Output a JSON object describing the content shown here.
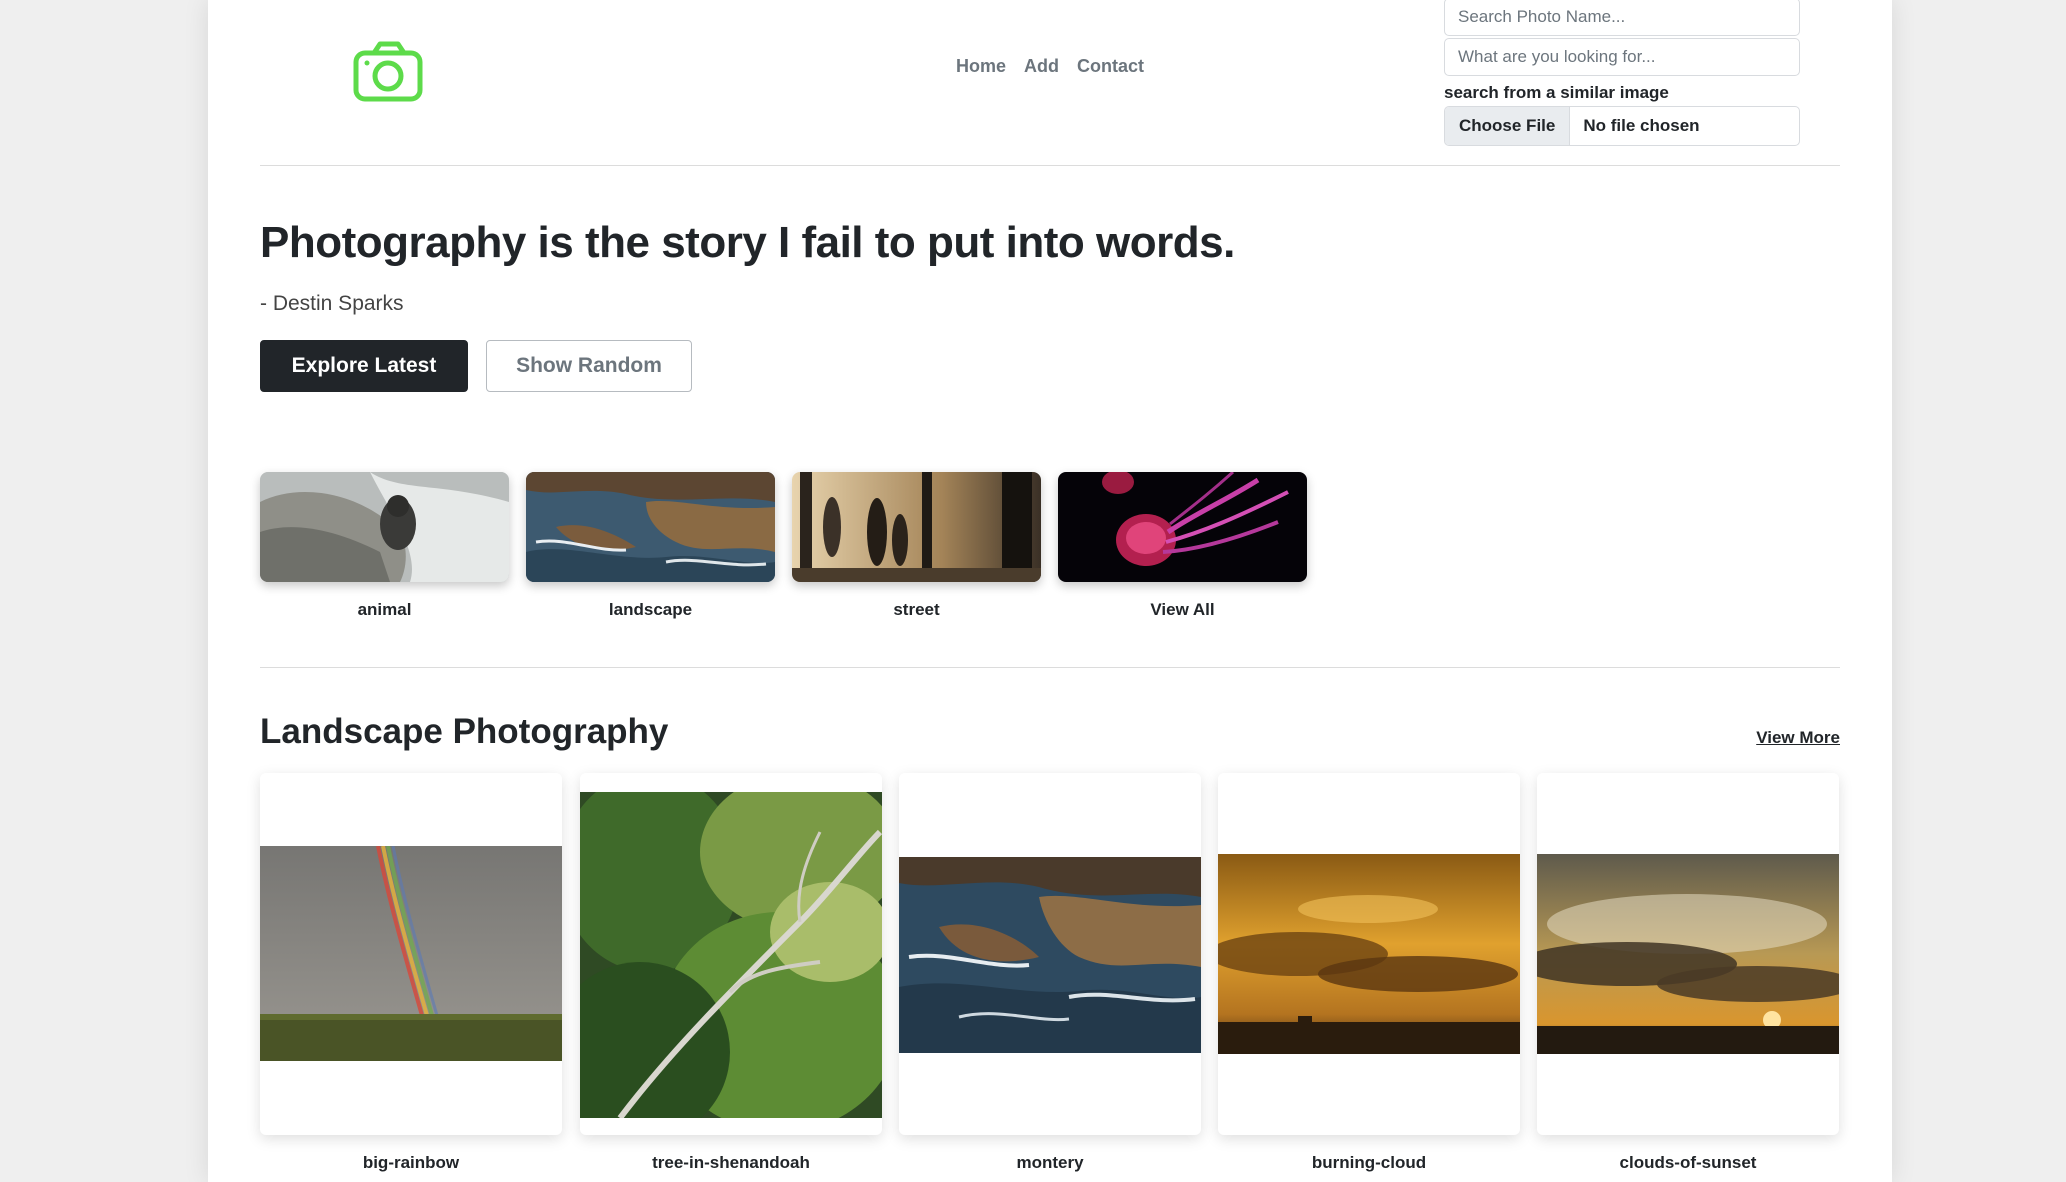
{
  "colors": {
    "logo": "#5ddb4a",
    "primary_dark": "#212529",
    "muted": "#6c757d"
  },
  "header": {
    "logo_icon": "camera-icon",
    "nav": [
      "Home",
      "Add",
      "Contact"
    ],
    "search_name_placeholder": "Search Photo Name...",
    "search_query_placeholder": "What are you looking for...",
    "similar_label": "search from a similar image",
    "file_button": "Choose File",
    "file_status": "No file chosen"
  },
  "hero": {
    "title": "Photography is the story I fail to put into words.",
    "author": "- Destin Sparks",
    "explore_label": "Explore Latest",
    "random_label": "Show Random"
  },
  "categories": [
    {
      "label": "animal"
    },
    {
      "label": "landscape"
    },
    {
      "label": "street"
    },
    {
      "label": "View All"
    }
  ],
  "section": {
    "title": "Landscape Photography",
    "view_more": "View More",
    "cards": [
      {
        "label": "big-rainbow"
      },
      {
        "label": "tree-in-shenandoah"
      },
      {
        "label": "montery"
      },
      {
        "label": "burning-cloud"
      },
      {
        "label": "clouds-of-sunset"
      }
    ]
  }
}
